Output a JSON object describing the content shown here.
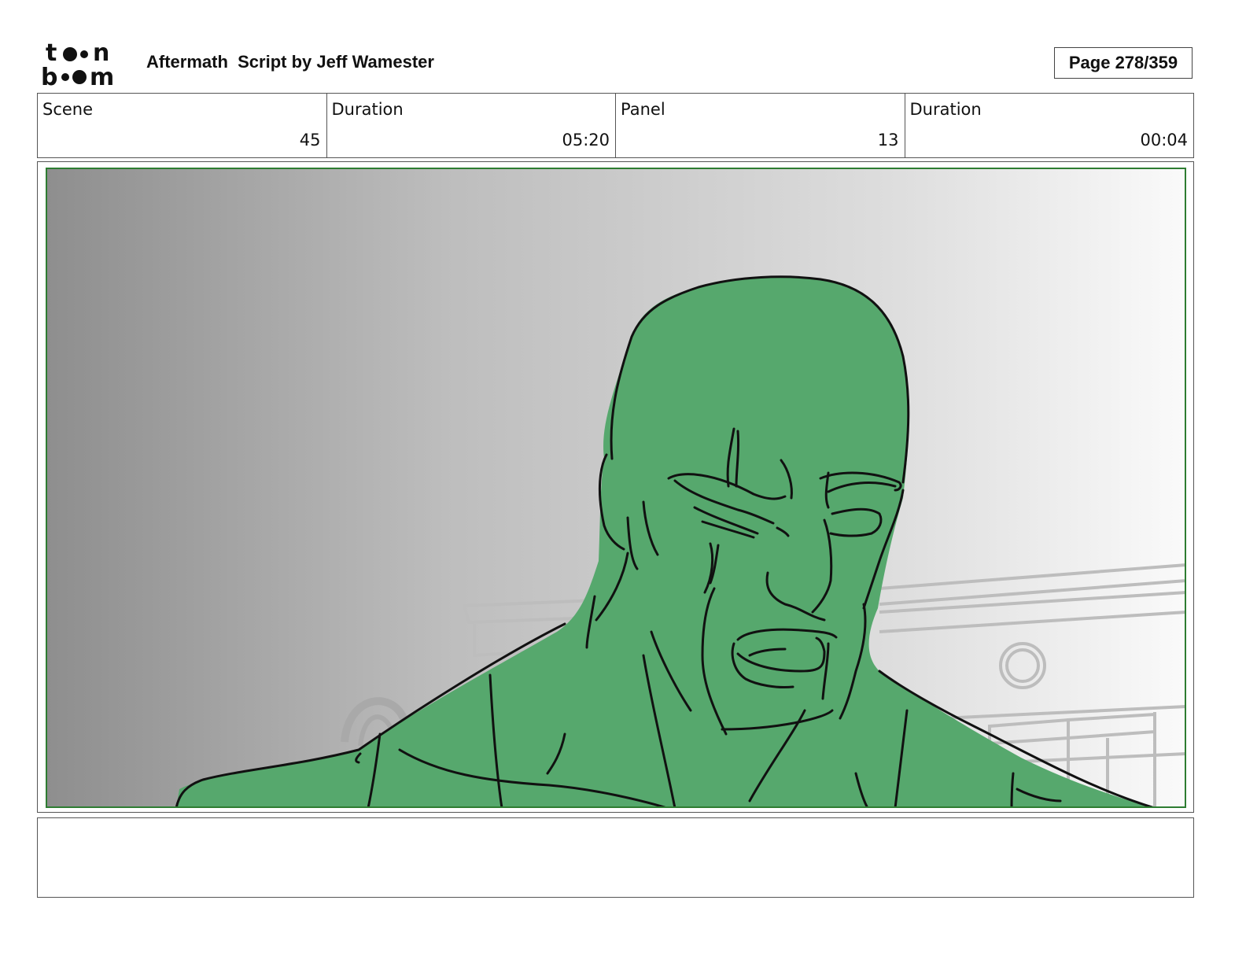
{
  "header": {
    "logo_text": "toon boom",
    "title": "Aftermath  Script by Jeff Wamester",
    "page": "Page 278/359"
  },
  "info": {
    "scene_label": "Scene",
    "scene_value": "45",
    "scene_duration_label": "Duration",
    "scene_duration_value": "05:20",
    "panel_label": "Panel",
    "panel_value": "13",
    "panel_duration_label": "Duration",
    "panel_duration_value": "00:04"
  },
  "colors": {
    "figure_fill": "#56a86d",
    "frame_green": "#2e7d32",
    "ink": "#111111"
  },
  "notes": ""
}
